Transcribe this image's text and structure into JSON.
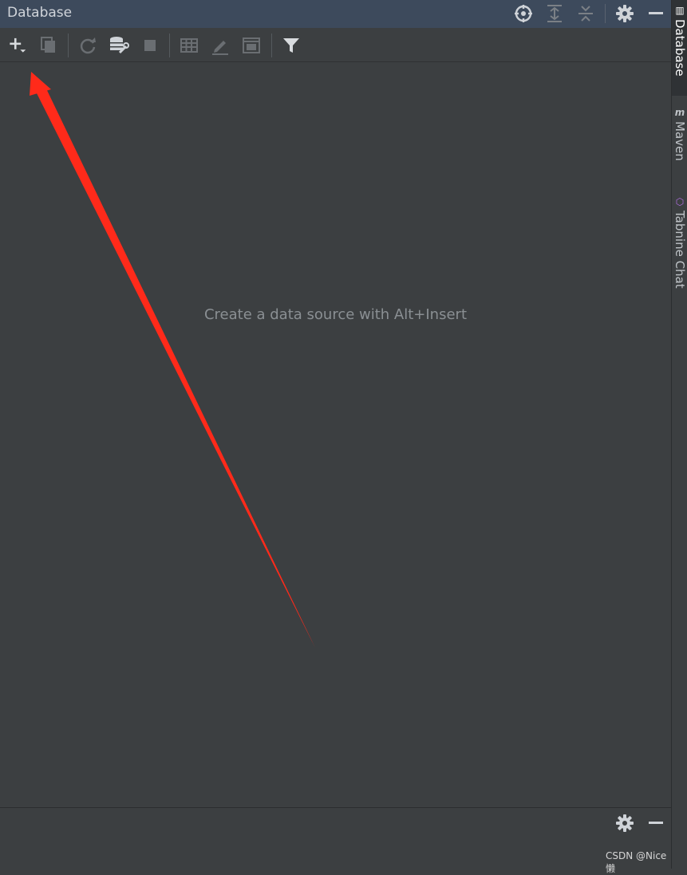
{
  "panel": {
    "title": "Database",
    "empty_hint": "Create a data source with Alt+Insert"
  },
  "header_actions": [
    "locate-icon",
    "expand-all-icon",
    "collapse-all-icon",
    "gear-icon",
    "minimize-icon"
  ],
  "toolbar": [
    "add-icon",
    "duplicate-icon",
    "refresh-icon",
    "data-source-properties-icon",
    "stop-icon",
    "table-editor-icon",
    "edit-source-icon",
    "query-console-icon",
    "filter-icon"
  ],
  "right_tabs": [
    {
      "label": "Database",
      "icon": "database-icon",
      "active": true
    },
    {
      "label": "Maven",
      "icon": "maven-icon",
      "active": false
    },
    {
      "label": "Tabnine Chat",
      "icon": "tabnine-icon",
      "active": false
    }
  ],
  "colors": {
    "background": "#3c3f41",
    "header": "#3d4a5c",
    "annotation_arrow": "#ff2a1a"
  },
  "watermark": "CSDN @Nice懒"
}
